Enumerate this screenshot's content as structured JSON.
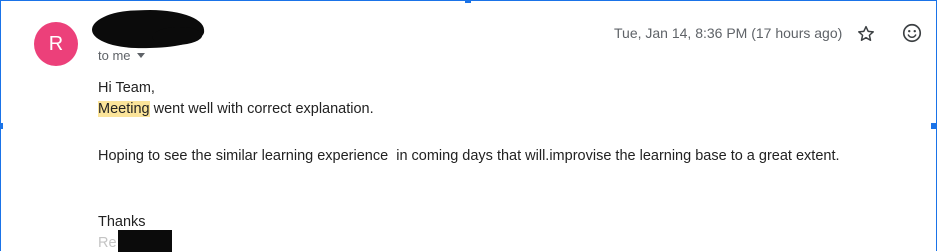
{
  "avatar": {
    "letter": "R",
    "color": "#ec407a"
  },
  "recipient": {
    "label": "to me"
  },
  "date": {
    "text": "Tue, Jan 14, 8:36 PM (17 hours ago)"
  },
  "actions": {
    "star_icon": "star-outline-icon",
    "emoji_icon": "emoji-react-icon"
  },
  "message": {
    "greeting": "Hi Team,",
    "highlighted_word": "Meeting",
    "line1_rest": " went well with correct explanation.",
    "line2": "Hoping to see the similar learning experience  in coming days that will.improvise the learning base to a great extent.",
    "closing": "Thanks",
    "signature_partial": "Re"
  },
  "colors": {
    "accent": "#1a73e8",
    "highlight": "#fbe49a",
    "meta_text": "#5f6368"
  }
}
